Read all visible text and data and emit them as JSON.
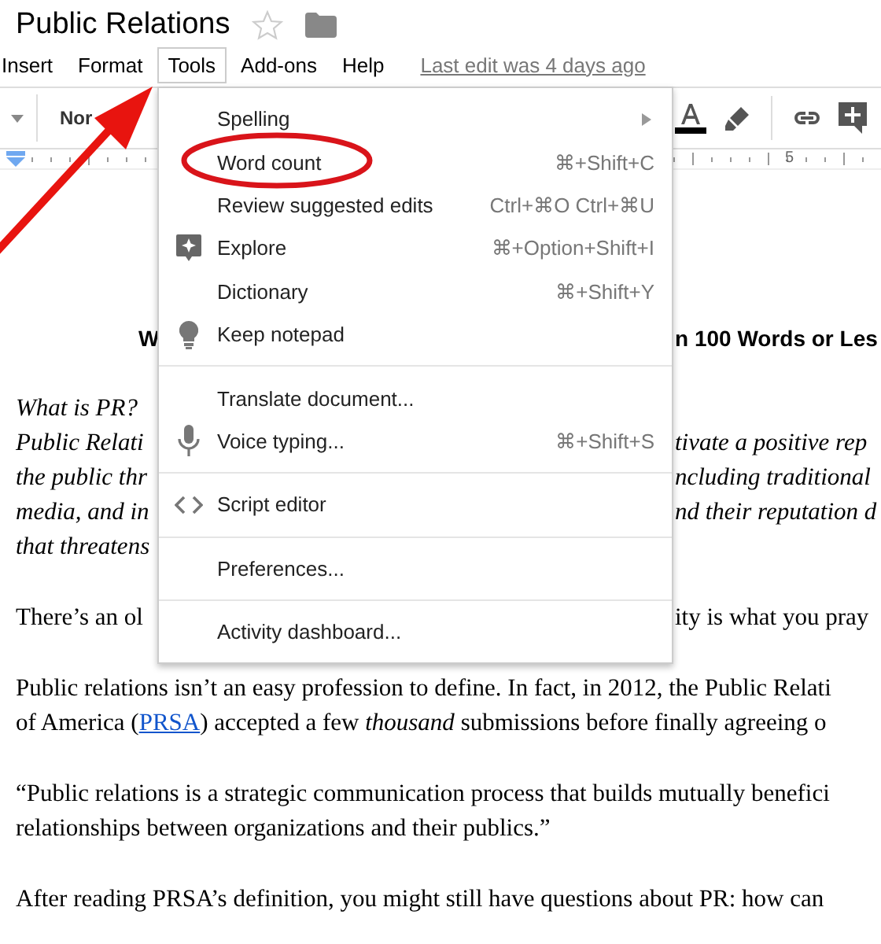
{
  "document_title": "Public Relations",
  "starred": false,
  "menubar": [
    {
      "label": "Insert",
      "selected": false
    },
    {
      "label": "Format",
      "selected": false
    },
    {
      "label": "Tools",
      "selected": true
    },
    {
      "label": "Add-ons",
      "selected": false
    },
    {
      "label": "Help",
      "selected": false
    }
  ],
  "last_edit": "Last edit was 4 days ago",
  "toolbar": {
    "style_dropdown": "Nor"
  },
  "ruler_label": "5",
  "tools_menu": [
    {
      "kind": "submenu",
      "label": "Spelling"
    },
    {
      "kind": "item",
      "label": "Word count",
      "shortcut": "⌘+Shift+C"
    },
    {
      "kind": "item",
      "label": "Review suggested edits",
      "shortcut": "Ctrl+⌘O Ctrl+⌘U"
    },
    {
      "kind": "explore",
      "label": "Explore",
      "shortcut": "⌘+Option+Shift+I"
    },
    {
      "kind": "item",
      "label": "Dictionary",
      "shortcut": "⌘+Shift+Y"
    },
    {
      "kind": "keep",
      "label": "Keep notepad"
    },
    {
      "kind": "separator"
    },
    {
      "kind": "item",
      "label": "Translate document..."
    },
    {
      "kind": "voice",
      "label": "Voice typing...",
      "shortcut": "⌘+Shift+S"
    },
    {
      "kind": "separator"
    },
    {
      "kind": "script",
      "label": "Script editor"
    },
    {
      "kind": "separator"
    },
    {
      "kind": "item",
      "label": "Preferences..."
    },
    {
      "kind": "separator"
    },
    {
      "kind": "item",
      "label": "Activity dashboard..."
    }
  ],
  "document": [
    {
      "kind": "heading",
      "lines": [
        {
          "left": "W",
          "right": "n 100 Words or Les"
        }
      ]
    },
    {
      "kind": "italic",
      "lines": [
        {
          "left": "What is PR?"
        },
        {
          "left": "Public Relati",
          "right": "tivate a positive rep"
        },
        {
          "left": "the public thr",
          "right": "ncluding traditional"
        },
        {
          "left": "media, and in",
          "right": "nd their reputation d"
        },
        {
          "left": "that threatens"
        }
      ]
    },
    {
      "kind": "plain",
      "lines": [
        {
          "left": "There’s an ol",
          "right": "ity is what you pray"
        }
      ]
    },
    {
      "kind": "plain",
      "lines": [
        {
          "parts": [
            {
              "kind": "text",
              "text": "Public relations isn’t an easy profession to define. In fact, in 2012, the Public Relati"
            }
          ]
        },
        {
          "parts": [
            {
              "kind": "text",
              "text": "of America ("
            },
            {
              "kind": "link",
              "text": "PRSA"
            },
            {
              "kind": "text",
              "text": ") accepted a few *thousand* submissions before finally agreeing o"
            }
          ]
        }
      ]
    },
    {
      "kind": "plain",
      "lines": [
        {
          "parts": [
            {
              "kind": "text",
              "text": "“Public relations is a strategic communication process that builds mutually benefici"
            }
          ]
        },
        {
          "parts": [
            {
              "kind": "text",
              "text": "relationships between organizations and their publics.”"
            }
          ]
        }
      ]
    },
    {
      "kind": "plain",
      "lines": [
        {
          "parts": [
            {
              "kind": "text",
              "text": "After reading PRSA’s definition, you might still have questions about PR: how can"
            }
          ]
        }
      ]
    }
  ]
}
